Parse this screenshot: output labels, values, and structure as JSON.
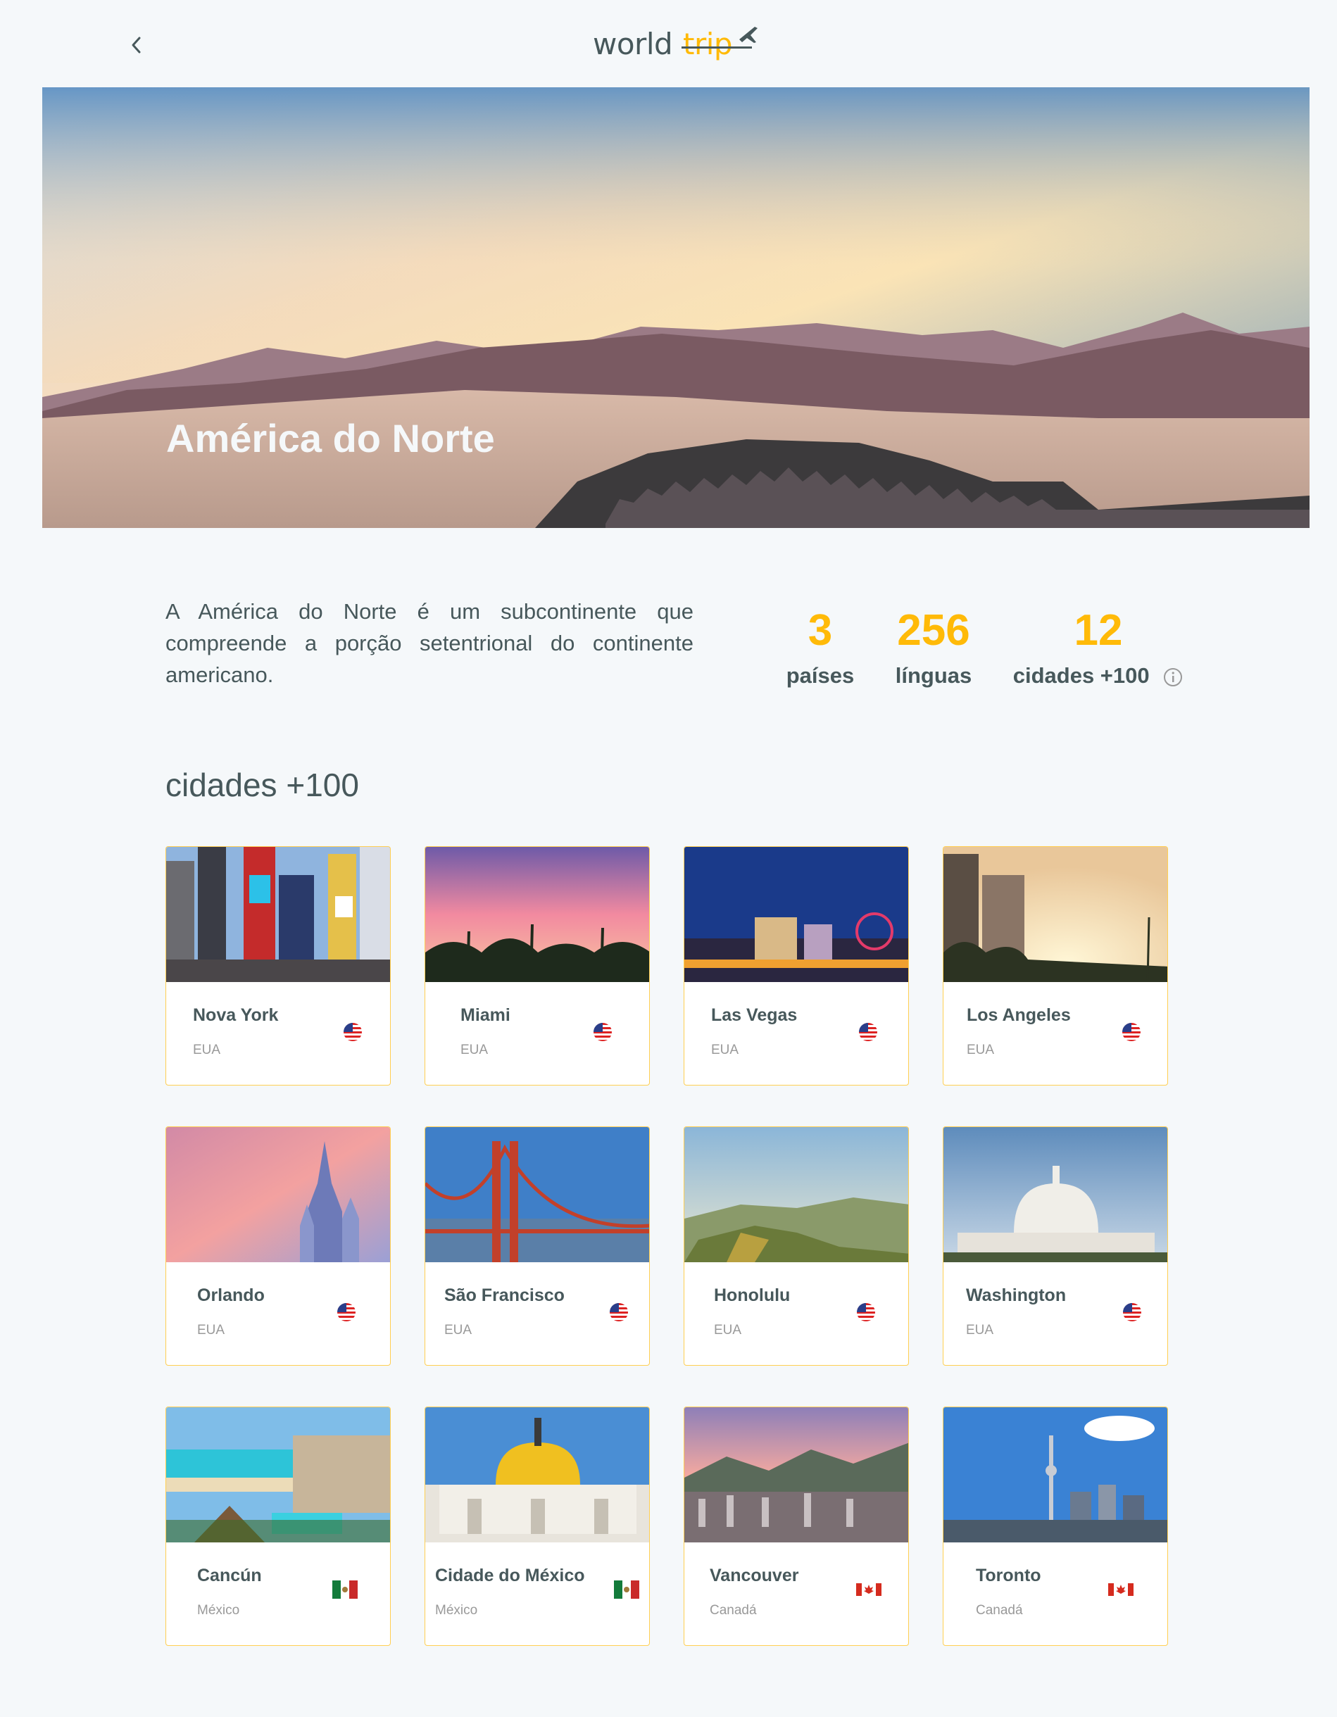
{
  "header": {
    "logo_world": "world",
    "logo_trip": "trip",
    "back_icon": "chevron-left-icon"
  },
  "banner": {
    "title": "América do Norte"
  },
  "info": {
    "description": "A América do Norte é um subcontinente que compreende a porção setentrional do continente americano.",
    "stats": [
      {
        "value": "3",
        "label": "países"
      },
      {
        "value": "256",
        "label": "línguas"
      },
      {
        "value": "12",
        "label": "cidades +100"
      }
    ]
  },
  "cities_section": {
    "title": "cidades +100",
    "cities": [
      {
        "name": "Nova York",
        "country": "EUA",
        "flag": "usa-flag-icon"
      },
      {
        "name": "Miami",
        "country": "EUA",
        "flag": "usa-flag-icon"
      },
      {
        "name": "Las Vegas",
        "country": "EUA",
        "flag": "usa-flag-icon"
      },
      {
        "name": "Los Angeles",
        "country": "EUA",
        "flag": "usa-flag-icon"
      },
      {
        "name": "Orlando",
        "country": "EUA",
        "flag": "usa-flag-icon"
      },
      {
        "name": "São Francisco",
        "country": "EUA",
        "flag": "usa-flag-icon"
      },
      {
        "name": "Honolulu",
        "country": "EUA",
        "flag": "usa-flag-icon"
      },
      {
        "name": "Washington",
        "country": "EUA",
        "flag": "usa-flag-icon"
      },
      {
        "name": "Cancún",
        "country": "México",
        "flag": "mexico-flag-icon"
      },
      {
        "name": "Cidade do México",
        "country": "México",
        "flag": "mexico-flag-icon"
      },
      {
        "name": "Vancouver",
        "country": "Canadá",
        "flag": "canada-flag-icon"
      },
      {
        "name": "Toronto",
        "country": "Canadá",
        "flag": "canada-flag-icon"
      }
    ]
  },
  "colors": {
    "accent": "#ffba08",
    "text": "#47585b",
    "background": "#f5f8fa"
  }
}
